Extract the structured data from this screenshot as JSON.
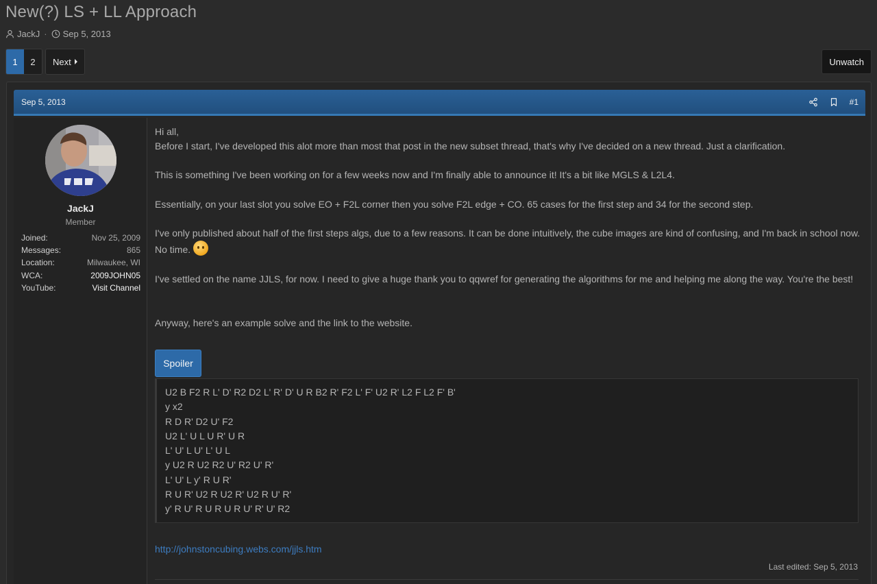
{
  "thread": {
    "title": "New(?) LS + LL Approach",
    "author": "JackJ",
    "date": "Sep 5, 2013",
    "separator": "·"
  },
  "pagination": {
    "pages": [
      "1",
      "2"
    ],
    "current": "1",
    "next_label": "Next"
  },
  "actions": {
    "unwatch_label": "Unwatch"
  },
  "post": {
    "date": "Sep 5, 2013",
    "number": "#1",
    "icons": [
      "share-icon",
      "bookmark-icon"
    ],
    "user": {
      "name": "JackJ",
      "title": "Member",
      "stats": [
        {
          "key": "Joined:",
          "value": "Nov 25, 2009"
        },
        {
          "key": "Messages:",
          "value": "865"
        },
        {
          "key": "Location:",
          "value": "Milwaukee, WI"
        },
        {
          "key": "WCA:",
          "value": "2009JOHN05"
        },
        {
          "key": "YouTube:",
          "value": "Visit Channel"
        }
      ]
    },
    "body": {
      "p1a": "Hi all,",
      "p1b": "Before I start, I've developed this alot more than most that post in the new subset thread, that's why I've decided on a new thread. Just a clarification.",
      "p2": "This is something I've been working on for a few weeks now and I'm finally able to announce it! It's a bit like MGLS & L2L4.",
      "p3": "Essentially, on your last slot you solve EO + F2L corner then you solve F2L edge + CO. 65 cases for the first step and 34 for the second step.",
      "p4": "I've only published about half of the first steps algs, due to a few reasons. It can be done intuitively, the cube images are kind of confusing, and I'm back in school now. No time.",
      "p5": "I've settled on the name JJLS, for now. I need to give a huge thank you to qqwref for generating the algorithms for me and helping me along the way. You're the best!",
      "p6": "Anyway, here's an example solve and the link to the website."
    },
    "spoiler": {
      "label": "Spoiler",
      "lines": [
        "U2 B F2 R L' D' R2 D2 L' R' D' U R B2 R' F2 L' F' U2 R' L2 F L2 F' B'",
        "y x2",
        "R D R' D2 U' F2",
        "U2 L' U L U R' U R",
        "L' U' L U' L' U L",
        "y U2 R U2 R2 U' R2 U' R'",
        "L' U' L y' R U R'",
        "R U R' U2 R U2 R' U2 R U' R'",
        "y' R U' R U R U R U' R' U' R2"
      ]
    },
    "link": "http://johnstoncubing.webs.com/jjls.htm",
    "last_edited": "Last edited: Sep 5, 2013"
  }
}
